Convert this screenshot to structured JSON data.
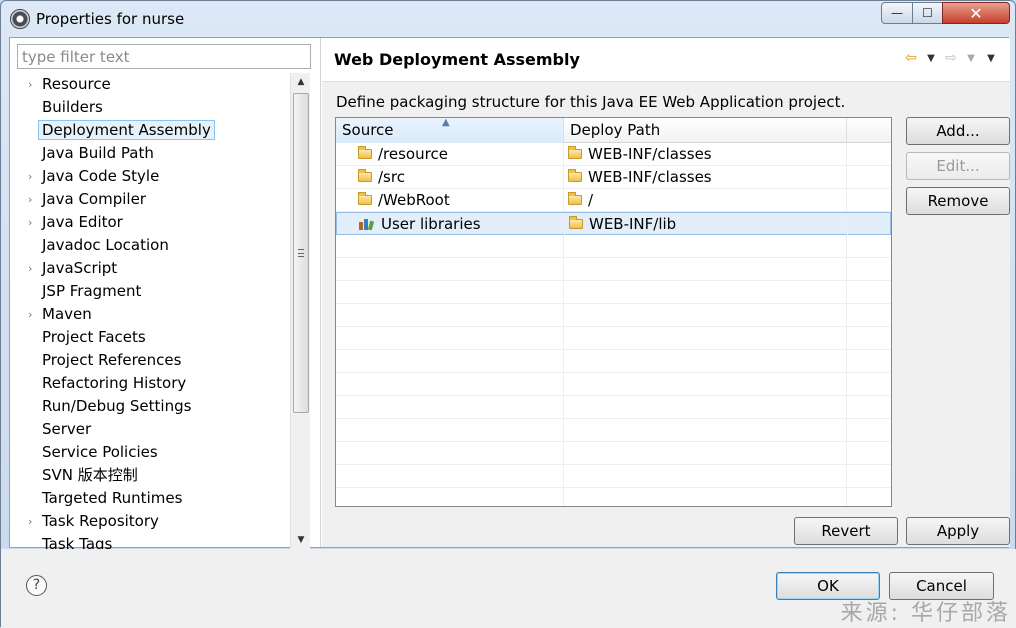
{
  "window": {
    "title": "Properties for nurse",
    "controls": {
      "minimize": "—",
      "maximize": "☐",
      "close": "✕"
    }
  },
  "filter": {
    "placeholder": "type filter text",
    "value": ""
  },
  "tree": {
    "items": [
      {
        "label": "Resource",
        "expandable": true
      },
      {
        "label": "Builders",
        "expandable": false
      },
      {
        "label": "Deployment Assembly",
        "expandable": false,
        "selected": true
      },
      {
        "label": "Java Build Path",
        "expandable": false
      },
      {
        "label": "Java Code Style",
        "expandable": true
      },
      {
        "label": "Java Compiler",
        "expandable": true
      },
      {
        "label": "Java Editor",
        "expandable": true
      },
      {
        "label": "Javadoc Location",
        "expandable": false
      },
      {
        "label": "JavaScript",
        "expandable": true
      },
      {
        "label": "JSP Fragment",
        "expandable": false
      },
      {
        "label": "Maven",
        "expandable": true
      },
      {
        "label": "Project Facets",
        "expandable": false
      },
      {
        "label": "Project References",
        "expandable": false
      },
      {
        "label": "Refactoring History",
        "expandable": false
      },
      {
        "label": "Run/Debug Settings",
        "expandable": false
      },
      {
        "label": "Server",
        "expandable": false
      },
      {
        "label": "Service Policies",
        "expandable": false
      },
      {
        "label": "SVN 版本控制",
        "expandable": false
      },
      {
        "label": "Targeted Runtimes",
        "expandable": false
      },
      {
        "label": "Task Repository",
        "expandable": true
      },
      {
        "label": "Task Tags",
        "expandable": false
      }
    ]
  },
  "page": {
    "title": "Web Deployment Assembly",
    "description": "Define packaging structure for this Java EE Web Application project.",
    "nav_icons": [
      "back-arrow-icon",
      "dropdown-icon",
      "forward-arrow-icon",
      "dropdown-icon",
      "menu-dropdown-icon"
    ]
  },
  "table": {
    "columns": [
      "Source",
      "Deploy Path",
      ""
    ],
    "rows": [
      {
        "source": "/resource",
        "deploy_path": "WEB-INF/classes",
        "source_icon": "folder-icon"
      },
      {
        "source": "/src",
        "deploy_path": "WEB-INF/classes",
        "source_icon": "folder-icon"
      },
      {
        "source": "/WebRoot",
        "deploy_path": "/",
        "source_icon": "folder-icon"
      },
      {
        "source": "User libraries",
        "deploy_path": "WEB-INF/lib",
        "source_icon": "library-icon",
        "selected": true
      }
    ],
    "empty_rows": 12
  },
  "buttons": {
    "add": "Add...",
    "edit": "Edit...",
    "remove": "Remove",
    "revert": "Revert",
    "apply": "Apply",
    "ok": "OK",
    "cancel": "Cancel"
  },
  "watermark": "来源: 华仔部落",
  "colors": {
    "selection": "#e3eefb",
    "selection_border": "#97bde6",
    "folder": "#f0c14a",
    "back_arrow": "#d89a10"
  }
}
